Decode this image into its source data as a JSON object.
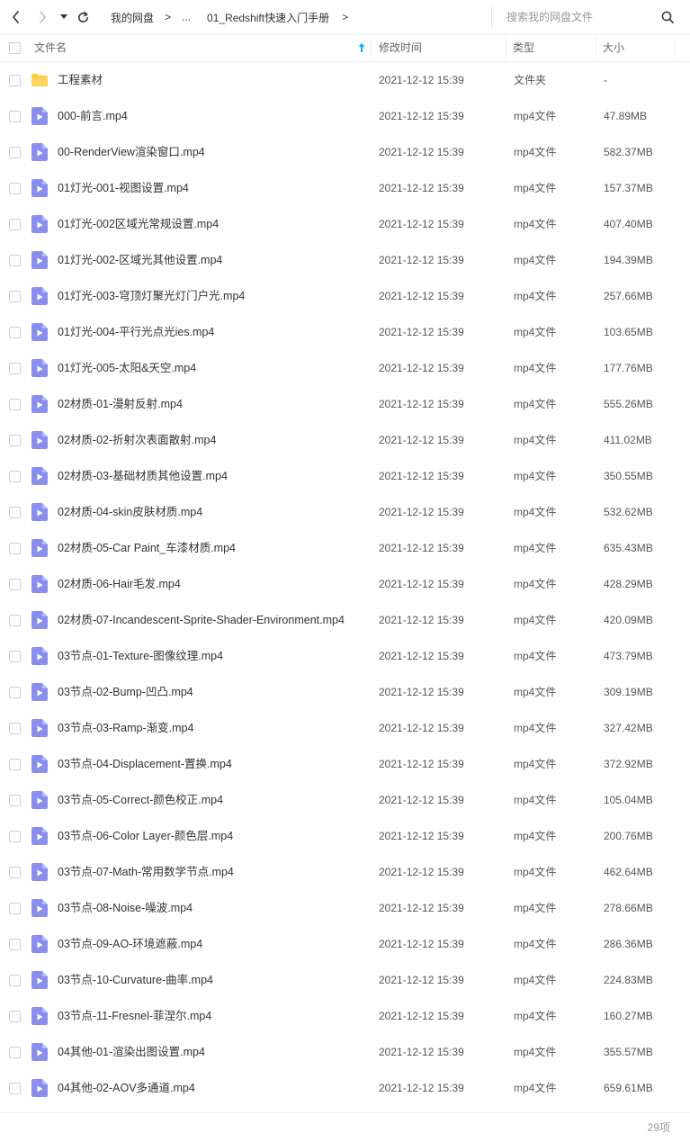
{
  "toolbar": {
    "back_icon": "chevron-left-icon",
    "forward_icon": "chevron-right-icon",
    "dropdown_icon": "caret-down-icon",
    "refresh_icon": "refresh-icon"
  },
  "breadcrumb": {
    "root": "我的网盘",
    "sep": ">",
    "ellipsis": "...",
    "current": "01_Redshift快速入门手册"
  },
  "search": {
    "placeholder": "搜索我的网盘文件",
    "icon": "search-icon"
  },
  "columns": {
    "name": "文件名",
    "time": "修改时间",
    "type": "类型",
    "size": "大小"
  },
  "colors": {
    "accent": "#06a7ff",
    "folder": "#ffc83d",
    "video_icon": "#8a8fef"
  },
  "files": [
    {
      "name": "工程素材",
      "time": "2021-12-12 15:39",
      "type": "文件夹",
      "size": "-",
      "kind": "folder"
    },
    {
      "name": "000-前言.mp4",
      "time": "2021-12-12 15:39",
      "type": "mp4文件",
      "size": "47.89MB",
      "kind": "video"
    },
    {
      "name": "00-RenderView渲染窗口.mp4",
      "time": "2021-12-12 15:39",
      "type": "mp4文件",
      "size": "582.37MB",
      "kind": "video"
    },
    {
      "name": "01灯光-001-视图设置.mp4",
      "time": "2021-12-12 15:39",
      "type": "mp4文件",
      "size": "157.37MB",
      "kind": "video"
    },
    {
      "name": "01灯光-002区域光常规设置.mp4",
      "time": "2021-12-12 15:39",
      "type": "mp4文件",
      "size": "407.40MB",
      "kind": "video"
    },
    {
      "name": "01灯光-002-区域光其他设置.mp4",
      "time": "2021-12-12 15:39",
      "type": "mp4文件",
      "size": "194.39MB",
      "kind": "video"
    },
    {
      "name": "01灯光-003-穹顶灯聚光灯门户光.mp4",
      "time": "2021-12-12 15:39",
      "type": "mp4文件",
      "size": "257.66MB",
      "kind": "video"
    },
    {
      "name": "01灯光-004-平行光点光ies.mp4",
      "time": "2021-12-12 15:39",
      "type": "mp4文件",
      "size": "103.65MB",
      "kind": "video"
    },
    {
      "name": "01灯光-005-太阳&天空.mp4",
      "time": "2021-12-12 15:39",
      "type": "mp4文件",
      "size": "177.76MB",
      "kind": "video"
    },
    {
      "name": "02材质-01-漫射反射.mp4",
      "time": "2021-12-12 15:39",
      "type": "mp4文件",
      "size": "555.26MB",
      "kind": "video"
    },
    {
      "name": "02材质-02-折射次表面散射.mp4",
      "time": "2021-12-12 15:39",
      "type": "mp4文件",
      "size": "411.02MB",
      "kind": "video"
    },
    {
      "name": "02材质-03-基础材质其他设置.mp4",
      "time": "2021-12-12 15:39",
      "type": "mp4文件",
      "size": "350.55MB",
      "kind": "video"
    },
    {
      "name": "02材质-04-skin皮肤材质.mp4",
      "time": "2021-12-12 15:39",
      "type": "mp4文件",
      "size": "532.62MB",
      "kind": "video"
    },
    {
      "name": "02材质-05-Car Paint_车漆材质.mp4",
      "time": "2021-12-12 15:39",
      "type": "mp4文件",
      "size": "635.43MB",
      "kind": "video"
    },
    {
      "name": "02材质-06-Hair毛发.mp4",
      "time": "2021-12-12 15:39",
      "type": "mp4文件",
      "size": "428.29MB",
      "kind": "video"
    },
    {
      "name": "02材质-07-Incandescent-Sprite-Shader-Environment.mp4",
      "time": "2021-12-12 15:39",
      "type": "mp4文件",
      "size": "420.09MB",
      "kind": "video"
    },
    {
      "name": "03节点-01-Texture-图像纹理.mp4",
      "time": "2021-12-12 15:39",
      "type": "mp4文件",
      "size": "473.79MB",
      "kind": "video"
    },
    {
      "name": "03节点-02-Bump-凹凸.mp4",
      "time": "2021-12-12 15:39",
      "type": "mp4文件",
      "size": "309.19MB",
      "kind": "video"
    },
    {
      "name": "03节点-03-Ramp-渐变.mp4",
      "time": "2021-12-12 15:39",
      "type": "mp4文件",
      "size": "327.42MB",
      "kind": "video"
    },
    {
      "name": "03节点-04-Displacement-置换.mp4",
      "time": "2021-12-12 15:39",
      "type": "mp4文件",
      "size": "372.92MB",
      "kind": "video"
    },
    {
      "name": "03节点-05-Correct-颜色校正.mp4",
      "time": "2021-12-12 15:39",
      "type": "mp4文件",
      "size": "105.04MB",
      "kind": "video"
    },
    {
      "name": "03节点-06-Color Layer-颜色层.mp4",
      "time": "2021-12-12 15:39",
      "type": "mp4文件",
      "size": "200.76MB",
      "kind": "video"
    },
    {
      "name": "03节点-07-Math-常用数学节点.mp4",
      "time": "2021-12-12 15:39",
      "type": "mp4文件",
      "size": "462.64MB",
      "kind": "video"
    },
    {
      "name": "03节点-08-Noise-噪波.mp4",
      "time": "2021-12-12 15:39",
      "type": "mp4文件",
      "size": "278.66MB",
      "kind": "video"
    },
    {
      "name": "03节点-09-AO-环境遮蔽.mp4",
      "time": "2021-12-12 15:39",
      "type": "mp4文件",
      "size": "286.36MB",
      "kind": "video"
    },
    {
      "name": "03节点-10-Curvature-曲率.mp4",
      "time": "2021-12-12 15:39",
      "type": "mp4文件",
      "size": "224.83MB",
      "kind": "video"
    },
    {
      "name": "03节点-11-Fresnel-菲涅尔.mp4",
      "time": "2021-12-12 15:39",
      "type": "mp4文件",
      "size": "160.27MB",
      "kind": "video"
    },
    {
      "name": "04其他-01-渲染出图设置.mp4",
      "time": "2021-12-12 15:39",
      "type": "mp4文件",
      "size": "355.57MB",
      "kind": "video"
    },
    {
      "name": "04其他-02-AOV多通道.mp4",
      "time": "2021-12-12 15:39",
      "type": "mp4文件",
      "size": "659.61MB",
      "kind": "video"
    }
  ],
  "footer": {
    "count": "29项"
  }
}
